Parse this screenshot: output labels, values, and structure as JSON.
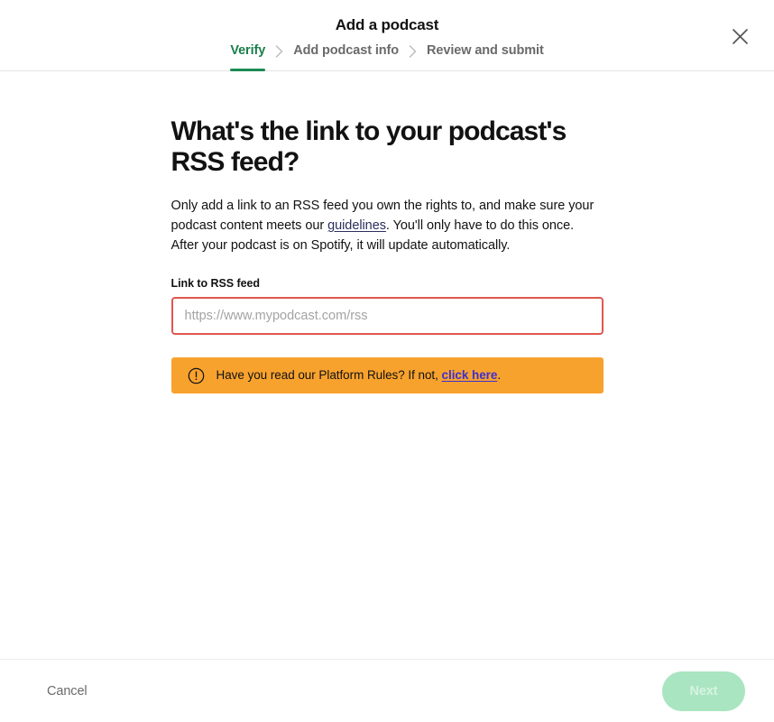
{
  "modal": {
    "title": "Add a podcast",
    "close_icon": "close-icon"
  },
  "stepper": {
    "separator_icon": "chevron-right-icon",
    "active_color": "#1a8b52",
    "steps": [
      {
        "label": "Verify",
        "active": true
      },
      {
        "label": "Add podcast info",
        "active": false
      },
      {
        "label": "Review and submit",
        "active": false
      }
    ]
  },
  "main": {
    "heading": "What's the link to your podcast's RSS feed?",
    "description_part1": "Only add a link to an RSS feed you own the rights to, and make sure your podcast content meets our ",
    "description_link": "guidelines",
    "description_part2": ". You'll only have to do this once. After your podcast is on Spotify, it will update automatically.",
    "field_label": "Link to RSS feed",
    "input_placeholder": "https://www.mypodcast.com/rss",
    "input_value": "",
    "input_border_color": "#e0574f"
  },
  "warning": {
    "icon": "exclamation-circle-icon",
    "text_before": "Have you read our Platform Rules? If not, ",
    "link_text": "click here",
    "text_after": ".",
    "background_color": "#f8a22e",
    "link_color": "#3d2fcf"
  },
  "footer": {
    "cancel_label": "Cancel",
    "next_label": "Next",
    "next_disabled": true,
    "next_color": "#a9e5c0"
  }
}
